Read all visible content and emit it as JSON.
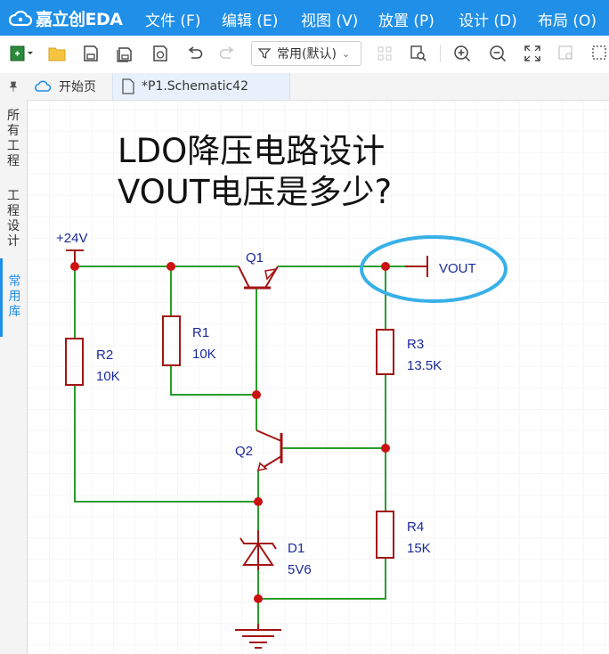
{
  "app": {
    "logo_text": "嘉立创EDA"
  },
  "menu": [
    {
      "label": "文件 (F)"
    },
    {
      "label": "编辑 (E)"
    },
    {
      "label": "视图 (V)"
    },
    {
      "label": "放置 (P)"
    },
    {
      "label": "设计 (D)"
    },
    {
      "label": "布局 (O)"
    }
  ],
  "toolbar": {
    "filter_label": "常用(默认)"
  },
  "tabs": [
    {
      "label": "开始页"
    },
    {
      "label": "*P1.Schematic42"
    }
  ],
  "left_panel": {
    "items": [
      {
        "label": "所有工程"
      },
      {
        "label": "工程设计"
      },
      {
        "label": "常用库"
      }
    ]
  },
  "schematic": {
    "title_line1": "LDO降压电路设计",
    "title_line2": "VOUT电压是多少?",
    "power_label": "+24V",
    "output_label": "VOUT",
    "components": {
      "q1": {
        "ref": "Q1"
      },
      "q2": {
        "ref": "Q2"
      },
      "r1": {
        "ref": "R1",
        "value": "10K"
      },
      "r2": {
        "ref": "R2",
        "value": "10K"
      },
      "r3": {
        "ref": "R3",
        "value": "13.5K"
      },
      "r4": {
        "ref": "R4",
        "value": "15K"
      },
      "d1": {
        "ref": "D1",
        "value": "5V6"
      }
    },
    "colors": {
      "wire": "#2a9d2a",
      "part": "#a31414",
      "junction": "#cc1111",
      "label": "#1a2a9a",
      "highlight": "#38b0e8",
      "grid": "#ececec"
    }
  }
}
